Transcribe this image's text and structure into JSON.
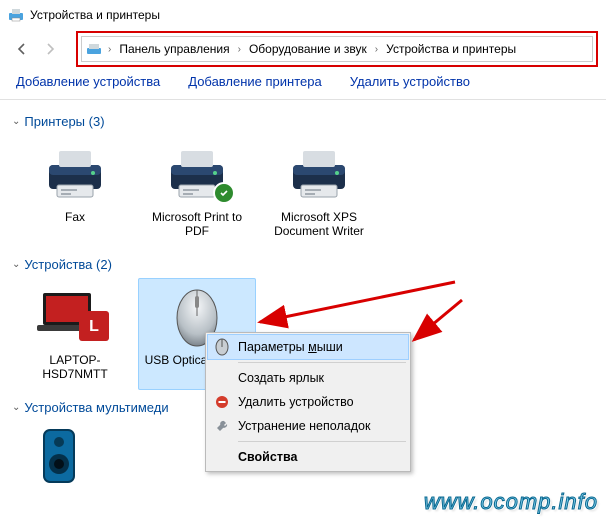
{
  "window": {
    "title": "Устройства и принтеры"
  },
  "breadcrumb": {
    "segments": [
      "Панель управления",
      "Оборудование и звук",
      "Устройства и принтеры"
    ]
  },
  "toolbar": {
    "add_device": "Добавление устройства",
    "add_printer": "Добавление принтера",
    "remove_device": "Удалить устройство"
  },
  "groups": {
    "printers": {
      "title": "Принтеры (3)",
      "items": [
        {
          "label": "Fax"
        },
        {
          "label": "Microsoft Print to PDF"
        },
        {
          "label": "Microsoft XPS Document Writer"
        }
      ]
    },
    "devices": {
      "title": "Устройства (2)",
      "items": [
        {
          "label": "LAPTOP-HSD7NMTT"
        },
        {
          "label": "USB Optical Mouse"
        }
      ]
    },
    "multimedia": {
      "title": "Устройства мультимеди"
    }
  },
  "context_menu": {
    "mouse_settings_pre": "Параметры ",
    "mouse_settings_u": "м",
    "mouse_settings_post": "ыши",
    "create_shortcut": "Создать ярлык",
    "remove_device": "Удалить устройство",
    "troubleshoot": "Устранение неполадок",
    "properties": "Свойства"
  },
  "watermark": "www.ocomp.info",
  "colors": {
    "highlight_red": "#d80000",
    "link_blue": "#004a99",
    "selection": "#cce8ff"
  }
}
